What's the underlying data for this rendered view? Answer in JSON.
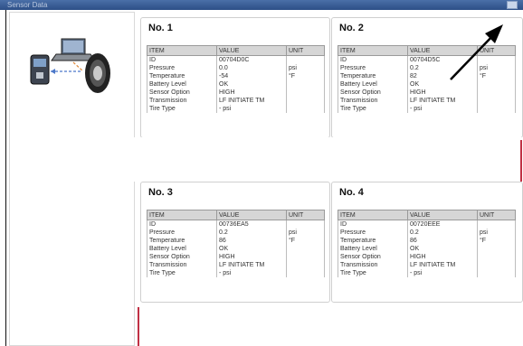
{
  "window": {
    "title": "Sensor Data"
  },
  "cards": [
    {
      "title": "No. 1",
      "headers": [
        "ITEM",
        "VALUE",
        "UNIT"
      ],
      "rows": [
        [
          "ID",
          "00704D0C",
          ""
        ],
        [
          "Pressure",
          "0.0",
          "psi"
        ],
        [
          "Temperature",
          "-54",
          "°F"
        ],
        [
          "Battery Level",
          "OK",
          ""
        ],
        [
          "Sensor Option",
          "HIGH",
          ""
        ],
        [
          "Transmission",
          "LF INITIATE TM",
          ""
        ],
        [
          "Tire Type",
          "- psi",
          ""
        ]
      ]
    },
    {
      "title": "No. 2",
      "headers": [
        "ITEM",
        "VALUE",
        "UNIT"
      ],
      "rows": [
        [
          "ID",
          "00704D5C",
          ""
        ],
        [
          "Pressure",
          "0.2",
          "psi"
        ],
        [
          "Temperature",
          "82",
          "°F"
        ],
        [
          "Battery Level",
          "OK",
          ""
        ],
        [
          "Sensor Option",
          "HIGH",
          ""
        ],
        [
          "Transmission",
          "LF INITIATE TM",
          ""
        ],
        [
          "Tire Type",
          "- psi",
          ""
        ]
      ]
    },
    {
      "title": "No. 3",
      "headers": [
        "ITEM",
        "VALUE",
        "UNIT"
      ],
      "rows": [
        [
          "ID",
          "00736EA5",
          ""
        ],
        [
          "Pressure",
          "0.2",
          "psi"
        ],
        [
          "Temperature",
          "86",
          "°F"
        ],
        [
          "Battery Level",
          "OK",
          ""
        ],
        [
          "Sensor Option",
          "HIGH",
          ""
        ],
        [
          "Transmission",
          "LF INITIATE TM",
          ""
        ],
        [
          "Tire Type",
          "- psi",
          ""
        ]
      ]
    },
    {
      "title": "No. 4",
      "headers": [
        "ITEM",
        "VALUE",
        "UNIT"
      ],
      "rows": [
        [
          "ID",
          "00720EEE",
          ""
        ],
        [
          "Pressure",
          "0.2",
          "psi"
        ],
        [
          "Temperature",
          "86",
          "°F"
        ],
        [
          "Battery Level",
          "OK",
          ""
        ],
        [
          "Sensor Option",
          "HIGH",
          ""
        ],
        [
          "Transmission",
          "LF INITIATE TM",
          ""
        ],
        [
          "Tire Type",
          "- psi",
          ""
        ]
      ]
    }
  ],
  "colors": {
    "accent_red": "#c03044",
    "titlebar": "#2d4f86",
    "table_header": "#d6d6d6"
  },
  "icons": [
    "laptop-icon",
    "tpms-tool-icon",
    "tire-icon",
    "close-icon",
    "arrow-pointer-icon"
  ]
}
